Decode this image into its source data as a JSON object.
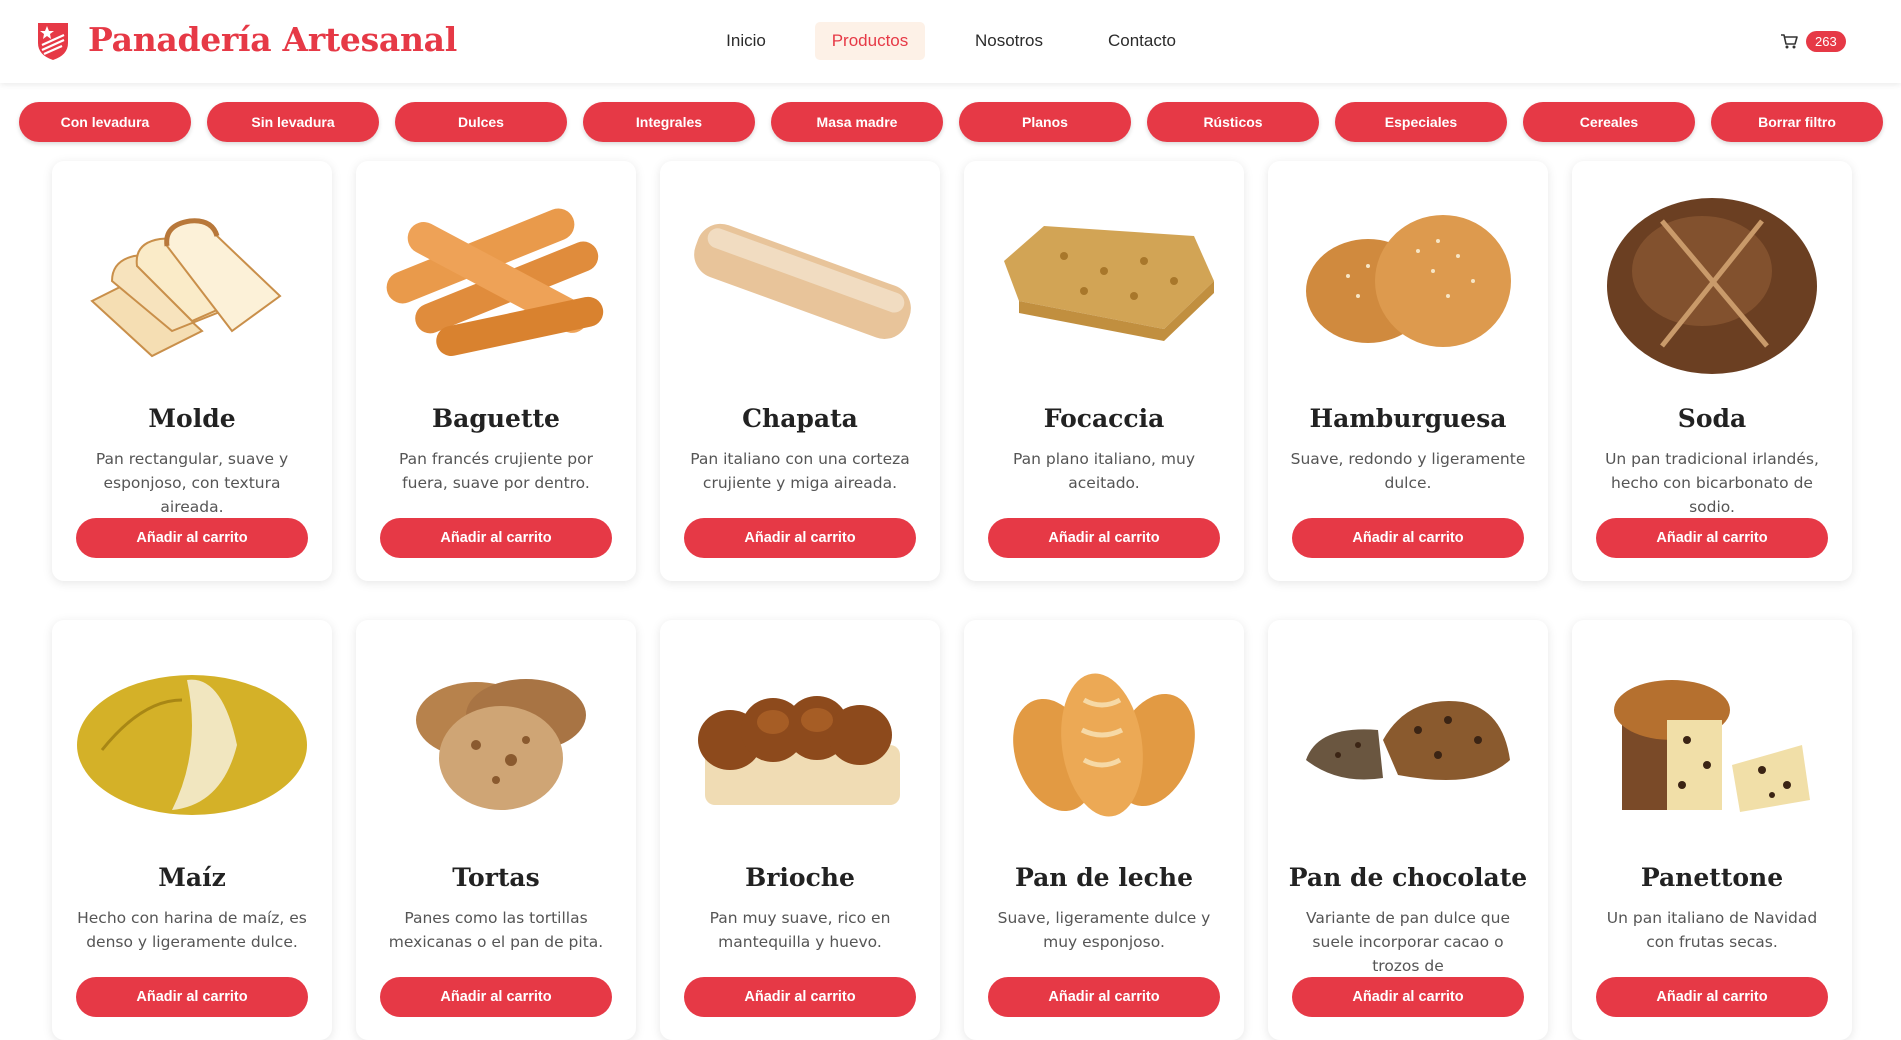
{
  "header": {
    "brand": "Panadería Artesanal",
    "nav": [
      {
        "label": "Inicio",
        "active": false
      },
      {
        "label": "Productos",
        "active": true
      },
      {
        "label": "Nosotros",
        "active": false
      },
      {
        "label": "Contacto",
        "active": false
      }
    ],
    "cart_count": "263"
  },
  "filters": [
    "Con levadura",
    "Sin levadura",
    "Dulces",
    "Integrales",
    "Masa madre",
    "Planos",
    "Rústicos",
    "Especiales",
    "Cereales",
    "Borrar filtro"
  ],
  "colors": {
    "accent": "#e63946",
    "active_nav_bg": "#fdf1e7"
  },
  "products": [
    {
      "name": "Molde",
      "desc": "Pan rectangular, suave y esponjoso, con textura aireada.",
      "button": "Añadir al carrito",
      "icon": "sliced-bread-icon"
    },
    {
      "name": "Baguette",
      "desc": "Pan francés crujiente por fuera, suave por dentro.",
      "button": "Añadir al carrito",
      "icon": "baguette-icon"
    },
    {
      "name": "Chapata",
      "desc": "Pan italiano con una corteza crujiente y miga aireada.",
      "button": "Añadir al carrito",
      "icon": "ciabatta-icon"
    },
    {
      "name": "Focaccia",
      "desc": "Pan plano italiano, muy aceitado.",
      "button": "Añadir al carrito",
      "icon": "focaccia-icon"
    },
    {
      "name": "Hamburguesa",
      "desc": "Suave, redondo y ligeramente dulce.",
      "button": "Añadir al carrito",
      "icon": "burger-bun-icon"
    },
    {
      "name": "Soda",
      "desc": "Un pan tradicional irlandés, hecho con bicarbonato de sodio.",
      "button": "Añadir al carrito",
      "icon": "soda-bread-icon"
    },
    {
      "name": "Maíz",
      "desc": "Hecho con harina de maíz, es denso y ligeramente dulce.",
      "button": "Añadir al carrito",
      "icon": "corn-bread-icon"
    },
    {
      "name": "Tortas",
      "desc": "Panes como las tortillas mexicanas o el pan de pita.",
      "button": "Añadir al carrito",
      "icon": "flatbread-icon"
    },
    {
      "name": "Brioche",
      "desc": "Pan muy suave, rico en mantequilla y huevo.",
      "button": "Añadir al carrito",
      "icon": "brioche-icon"
    },
    {
      "name": "Pan de leche",
      "desc": "Suave, ligeramente dulce y muy esponjoso.",
      "button": "Añadir al carrito",
      "icon": "milk-bread-icon"
    },
    {
      "name": "Pan de chocolate",
      "desc": "Variante de pan dulce que suele incorporar cacao o trozos de",
      "button": "Añadir al carrito",
      "icon": "chocolate-bread-icon"
    },
    {
      "name": "Panettone",
      "desc": "Un pan italiano de Navidad con frutas secas.",
      "button": "Añadir al carrito",
      "icon": "panettone-icon"
    }
  ]
}
